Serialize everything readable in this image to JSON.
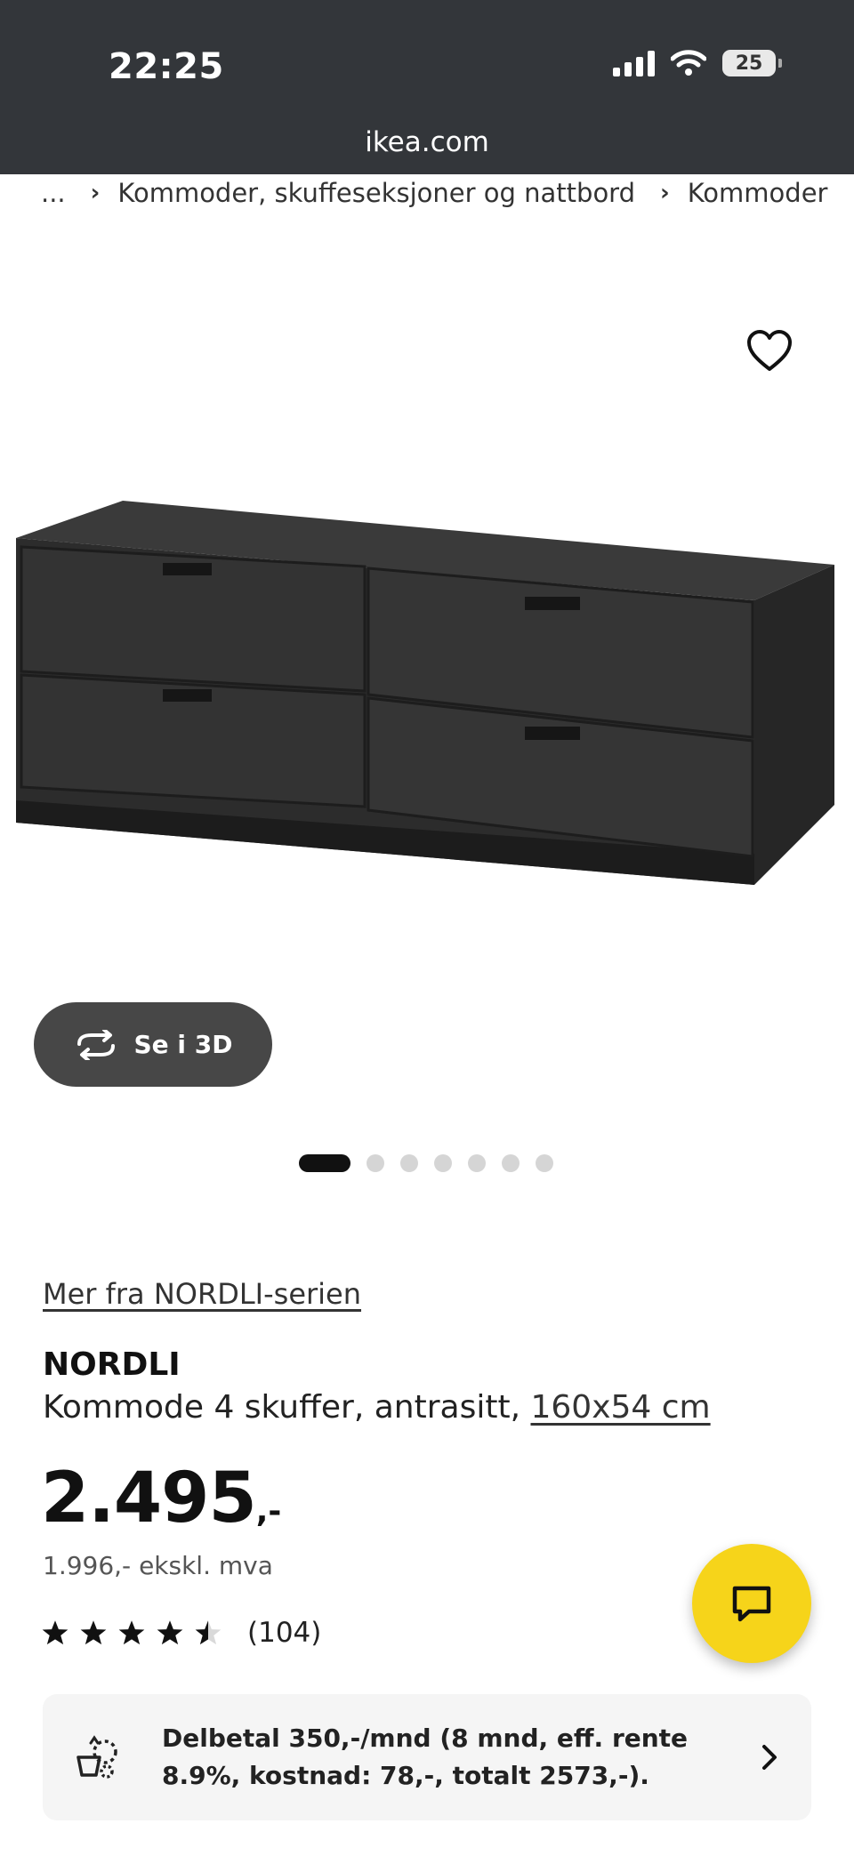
{
  "status_bar": {
    "time": "22:25",
    "battery": "25"
  },
  "browser": {
    "url": "ikea.com"
  },
  "breadcrumb": {
    "items": [
      "...",
      "Kommoder, skuffeseksjoner og nattbord",
      "Kommoder"
    ]
  },
  "gallery": {
    "view_3d_label": "Se i 3D",
    "dot_count": 7,
    "active_index": 0
  },
  "product": {
    "series_link": "Mer fra NORDLI-serien",
    "name": "NORDLI",
    "description": "Kommode 4 skuffer, antrasitt, ",
    "size": "160x54 cm",
    "price_main": "2.495",
    "price_decimal": ",-",
    "price_ex_vat": "1.996,- ekskl. mva",
    "rating_value": 4.5,
    "rating_count": "(104)"
  },
  "finance": {
    "text": "Delbetal 350,-/mnd (8 mnd, eff. rente 8.9%, kostnad: 78,-, totalt 2573,-)."
  },
  "colors": {
    "status_bar_bg": "#33363a",
    "chat_fab": "#f6d41a",
    "product_dark": "#2e2e2e"
  },
  "icons": {
    "favorite": "heart-icon",
    "view_3d": "rotate-3d-icon",
    "chat": "chat-icon",
    "finance": "piggy-bank-icon",
    "arrow": "chevron-right-icon"
  }
}
